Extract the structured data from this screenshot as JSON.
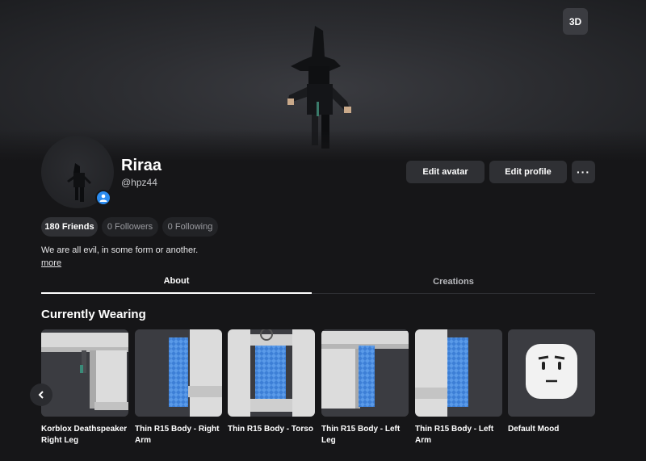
{
  "hero": {
    "view_toggle_label": "3D"
  },
  "profile": {
    "display_name": "Riraa",
    "username": "@hpz44",
    "bio": "We are all evil, in some form or another.",
    "more_label": "more"
  },
  "actions": {
    "edit_avatar": "Edit avatar",
    "edit_profile": "Edit profile",
    "more": "···"
  },
  "stats": {
    "friends": "180 Friends",
    "followers": "0 Followers",
    "following": "0 Following"
  },
  "tabs": [
    {
      "label": "About"
    },
    {
      "label": "Creations"
    }
  ],
  "currently_wearing": {
    "title": "Currently Wearing",
    "items": [
      {
        "name": "Korblox Deathspeaker Right Leg"
      },
      {
        "name": "Thin R15 Body - Right Arm"
      },
      {
        "name": "Thin R15 Body - Torso"
      },
      {
        "name": "Thin R15 Body - Left Leg"
      },
      {
        "name": "Thin R15 Body - Left Arm"
      },
      {
        "name": "Default Mood"
      }
    ]
  },
  "colors": {
    "accent_blue": "#2b8cf0",
    "background": "#161618",
    "button": "#2f3034"
  }
}
